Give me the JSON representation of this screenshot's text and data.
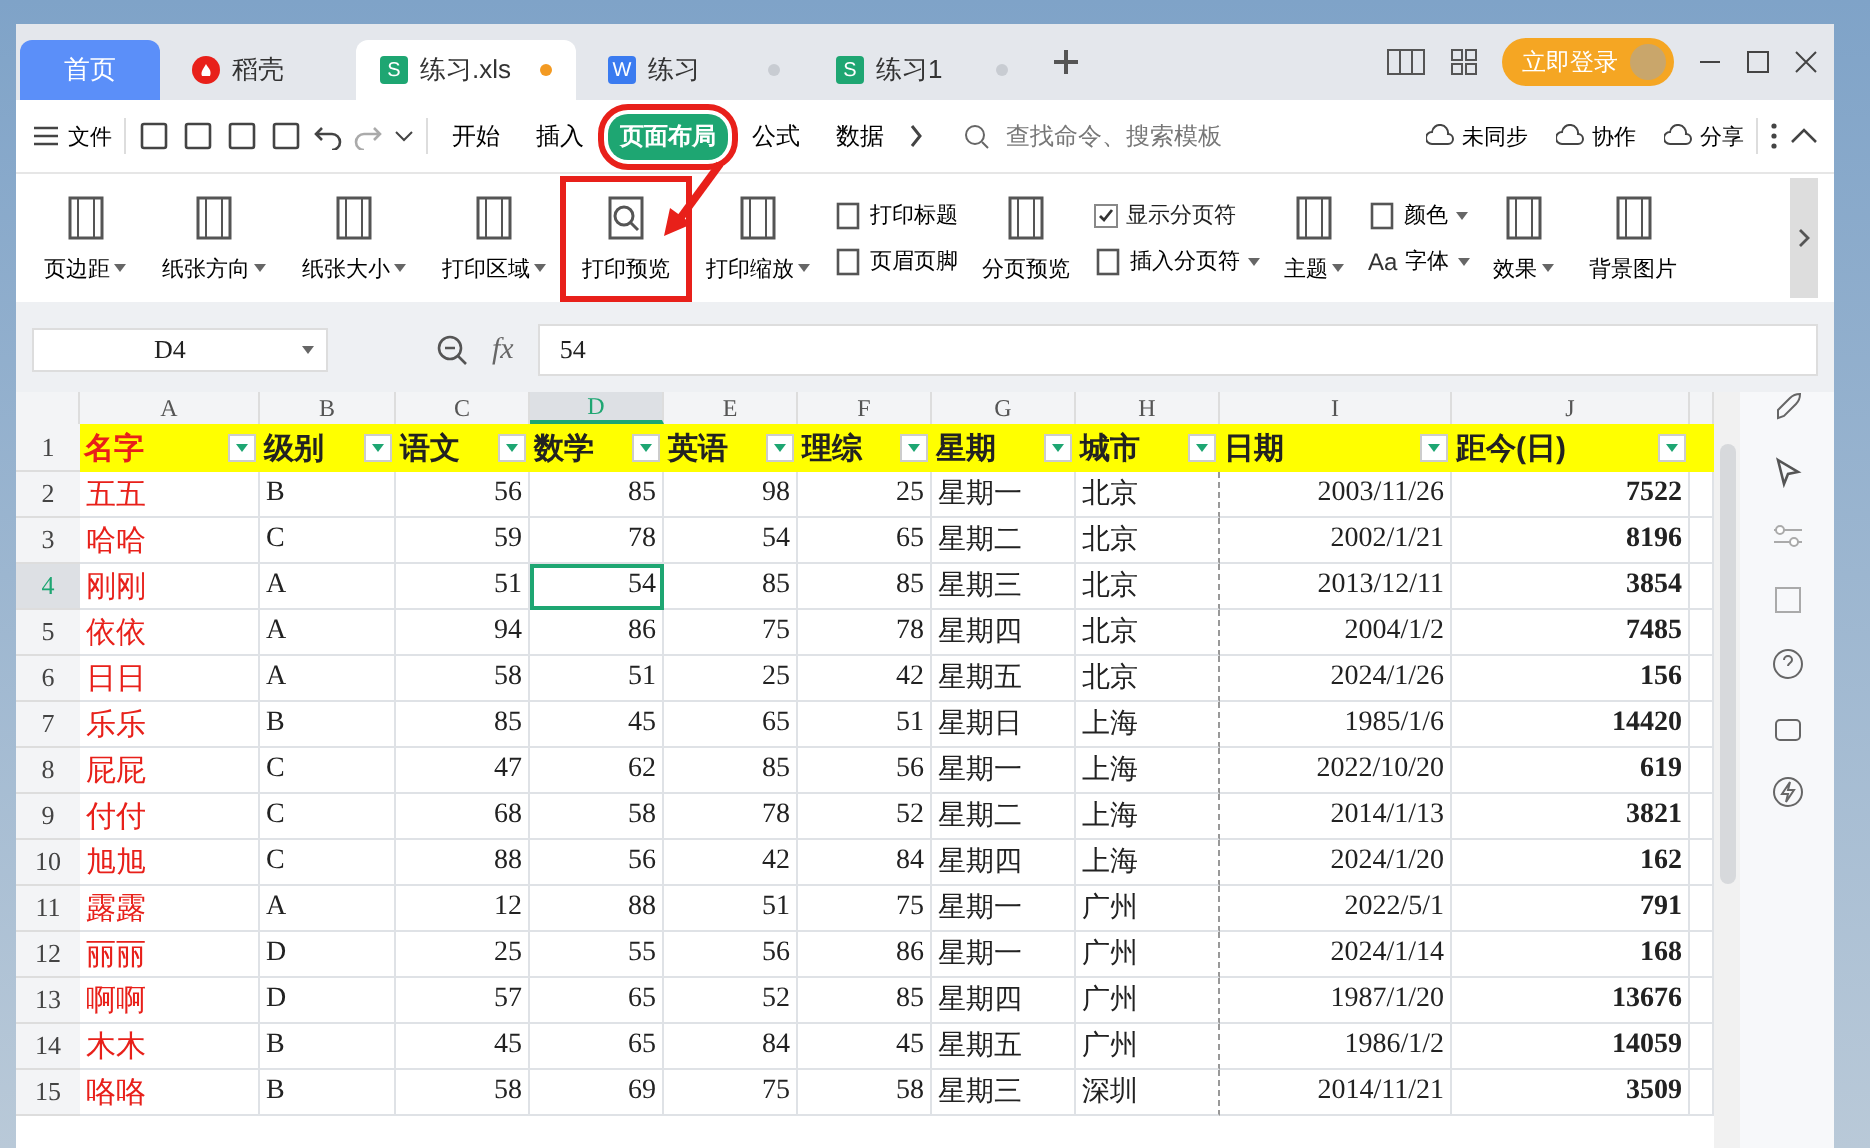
{
  "tabs": [
    {
      "label": "首页",
      "kind": "home",
      "selected": false
    },
    {
      "label": "稻壳",
      "kind": "docer",
      "selected": false
    },
    {
      "label": "练习.xls",
      "kind": "sheet",
      "icon": "S",
      "selected": true,
      "unsaved": true
    },
    {
      "label": "练习",
      "kind": "writer",
      "icon": "W",
      "selected": false,
      "unsaved": false
    },
    {
      "label": "练习1",
      "kind": "sheet",
      "icon": "S",
      "selected": false,
      "unsaved": false
    }
  ],
  "login_button": "立即登录",
  "menu": "文件",
  "ribbon_tabs": [
    {
      "label": "开始",
      "selected": false,
      "annotated": false
    },
    {
      "label": "插入",
      "selected": false,
      "annotated": false
    },
    {
      "label": "页面布局",
      "selected": true,
      "annotated": true
    },
    {
      "label": "公式",
      "selected": false,
      "annotated": false
    },
    {
      "label": "数据",
      "selected": false,
      "annotated": false
    }
  ],
  "search": {
    "placeholder": "查找命令、搜索模板"
  },
  "actions": [
    "未同步",
    "协作",
    "分享"
  ],
  "ribbon": [
    {
      "kind": "large",
      "label": "页边距",
      "dropdown": true
    },
    {
      "kind": "large",
      "label": "纸张方向",
      "dropdown": true
    },
    {
      "kind": "large",
      "label": "纸张大小",
      "dropdown": true
    },
    {
      "kind": "large",
      "label": "打印区域",
      "dropdown": true
    },
    {
      "kind": "large",
      "label": "打印预览",
      "dropdown": false,
      "annotated": true
    },
    {
      "kind": "large",
      "label": "打印缩放",
      "dropdown": true
    },
    {
      "kind": "stack",
      "items": [
        {
          "kind": "small",
          "label": "打印标题",
          "dropdown": false
        },
        {
          "kind": "small",
          "label": "页眉页脚",
          "dropdown": false
        }
      ]
    },
    {
      "kind": "large",
      "label": "分页预览",
      "dropdown": false
    },
    {
      "kind": "stack",
      "items": [
        {
          "kind": "checkbox",
          "label": "显示分页符",
          "checked": true
        },
        {
          "kind": "small",
          "label": "插入分页符",
          "dropdown": true
        }
      ]
    },
    {
      "kind": "large",
      "label": "主题",
      "dropdown": true
    },
    {
      "kind": "stack",
      "items": [
        {
          "kind": "small",
          "label": "颜色",
          "dropdown": true
        },
        {
          "kind": "small",
          "label": "字体",
          "dropdown": true,
          "glyph": "Aa"
        }
      ]
    },
    {
      "kind": "large",
      "label": "效果",
      "dropdown": true
    },
    {
      "kind": "large",
      "label": "背景图片",
      "dropdown": false
    }
  ],
  "formula_bar": {
    "cell": "D4",
    "fx": "fx",
    "value": "54"
  },
  "sheet": {
    "columns": [
      {
        "letter": "A",
        "selected": false
      },
      {
        "letter": "B",
        "selected": false
      },
      {
        "letter": "C",
        "selected": false
      },
      {
        "letter": "D",
        "selected": true
      },
      {
        "letter": "E",
        "selected": false
      },
      {
        "letter": "F",
        "selected": false
      },
      {
        "letter": "G",
        "selected": false
      },
      {
        "letter": "H",
        "selected": false
      },
      {
        "letter": "I",
        "selected": false
      },
      {
        "letter": "J",
        "selected": false
      }
    ],
    "header_num": "1",
    "header": [
      "名字",
      "级别",
      "语文",
      "数学",
      "英语",
      "理综",
      "星期",
      "城市",
      "日期",
      "距今(日)"
    ],
    "rows": [
      {
        "num": "2",
        "selected": false,
        "cells": [
          "五五",
          "B",
          "56",
          "85",
          "98",
          "25",
          "星期一",
          "北京",
          "2003/11/26",
          "7522"
        ]
      },
      {
        "num": "3",
        "selected": false,
        "cells": [
          "哈哈",
          "C",
          "59",
          "78",
          "54",
          "65",
          "星期二",
          "北京",
          "2002/1/21",
          "8196"
        ]
      },
      {
        "num": "4",
        "selected": true,
        "cells": [
          "刚刚",
          "A",
          "51",
          "54",
          "85",
          "85",
          "星期三",
          "北京",
          "2013/12/11",
          "3854"
        ]
      },
      {
        "num": "5",
        "selected": false,
        "cells": [
          "依依",
          "A",
          "94",
          "86",
          "75",
          "78",
          "星期四",
          "北京",
          "2004/1/2",
          "7485"
        ]
      },
      {
        "num": "6",
        "selected": false,
        "cells": [
          "日日",
          "A",
          "58",
          "51",
          "25",
          "42",
          "星期五",
          "北京",
          "2024/1/26",
          "156"
        ]
      },
      {
        "num": "7",
        "selected": false,
        "cells": [
          "乐乐",
          "B",
          "85",
          "45",
          "65",
          "51",
          "星期日",
          "上海",
          "1985/1/6",
          "14420"
        ]
      },
      {
        "num": "8",
        "selected": false,
        "cells": [
          "屁屁",
          "C",
          "47",
          "62",
          "85",
          "56",
          "星期一",
          "上海",
          "2022/10/20",
          "619"
        ]
      },
      {
        "num": "9",
        "selected": false,
        "cells": [
          "付付",
          "C",
          "68",
          "58",
          "78",
          "52",
          "星期二",
          "上海",
          "2014/1/13",
          "3821"
        ]
      },
      {
        "num": "10",
        "selected": false,
        "cells": [
          "旭旭",
          "C",
          "88",
          "56",
          "42",
          "84",
          "星期四",
          "上海",
          "2024/1/20",
          "162"
        ]
      },
      {
        "num": "11",
        "selected": false,
        "cells": [
          "露露",
          "A",
          "12",
          "88",
          "51",
          "75",
          "星期一",
          "广州",
          "2022/5/1",
          "791"
        ]
      },
      {
        "num": "12",
        "selected": false,
        "cells": [
          "丽丽",
          "D",
          "25",
          "55",
          "56",
          "86",
          "星期一",
          "广州",
          "2024/1/14",
          "168"
        ]
      },
      {
        "num": "13",
        "selected": false,
        "cells": [
          "啊啊",
          "D",
          "57",
          "65",
          "52",
          "85",
          "星期四",
          "广州",
          "1987/1/20",
          "13676"
        ]
      },
      {
        "num": "14",
        "selected": false,
        "cells": [
          "木木",
          "B",
          "45",
          "65",
          "84",
          "45",
          "星期五",
          "广州",
          "1986/1/2",
          "14059"
        ]
      },
      {
        "num": "15",
        "selected": false,
        "cells": [
          "咯咯",
          "B",
          "58",
          "69",
          "75",
          "58",
          "星期三",
          "深圳",
          "2014/11/21",
          "3509"
        ]
      }
    ]
  }
}
